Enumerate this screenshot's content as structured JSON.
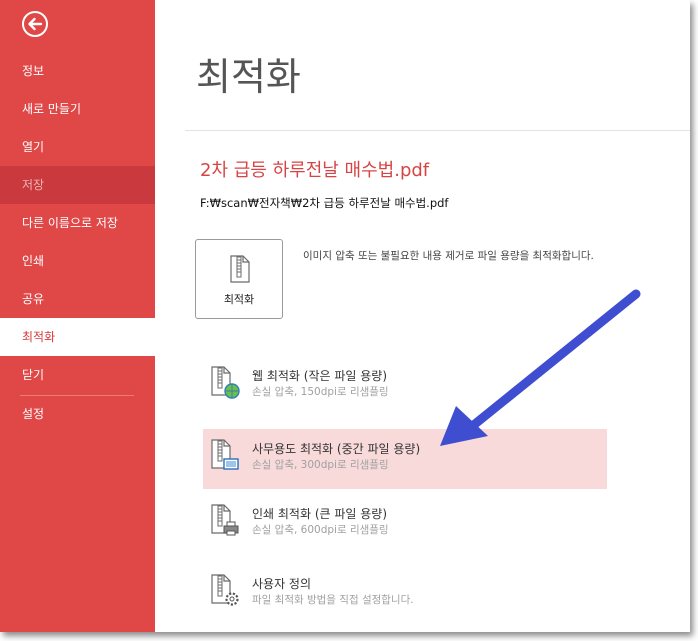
{
  "sidebar": {
    "items": [
      {
        "label": "정보"
      },
      {
        "label": "새로 만들기"
      },
      {
        "label": "열기"
      },
      {
        "label": "저장"
      },
      {
        "label": "다른 이름으로 저장"
      },
      {
        "label": "인쇄"
      },
      {
        "label": "공유"
      },
      {
        "label": "최적화"
      },
      {
        "label": "닫기"
      },
      {
        "label": "설정"
      }
    ],
    "active_item": "최적화",
    "disabled_item": "저장"
  },
  "main": {
    "title": "최적화",
    "file_name": "2차 급등 하루전날 매수법.pdf",
    "file_path": "F:₩scan₩전자책₩2차 급등 하루전날 매수법.pdf",
    "optimize_button": {
      "label": "최적화",
      "icon": "zipper-file-icon"
    },
    "description": "이미지 압축 또는 불필요한 내용 제거로 파일 용량을 최적화합니다.",
    "presets": [
      {
        "name": "웹 최적화 (작은 파일 용량)",
        "sub": "손실 압축, 150dpi로 리샘플링",
        "icon": "web-globe-icon"
      },
      {
        "name": "사무용도 최적화 (중간 파일 용량)",
        "sub": "손실 압축, 300dpi로 리샘플링",
        "icon": "monitor-icon",
        "selected": true
      },
      {
        "name": "인쇄 최적화 (큰 파일 용량)",
        "sub": "손실 압축, 600dpi로 리샘플링",
        "icon": "printer-icon"
      },
      {
        "name": "사용자 정의",
        "sub": "파일 최적화 방법을 직접 설정합니다.",
        "icon": "gear-icon"
      }
    ]
  },
  "colors": {
    "accent": "#e04848",
    "disabled_bg": "#c9393d",
    "selected_bg": "#f9dada",
    "annotation_arrow": "#3f4ed0"
  }
}
